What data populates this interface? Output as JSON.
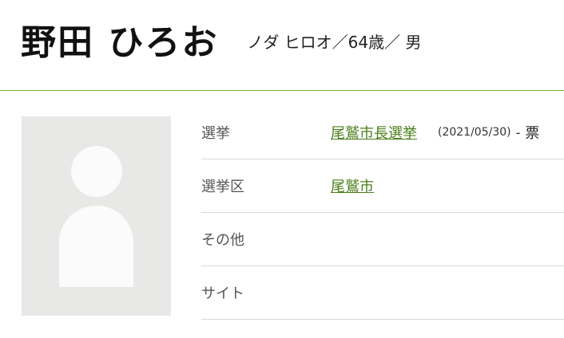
{
  "profile": {
    "name": "野田 ひろお",
    "reading": "ノダ ヒロオ／64歳／ 男"
  },
  "info": {
    "rows": [
      {
        "label": "選挙",
        "link": "尾鷲市長選挙",
        "date": "(2021/05/30)",
        "dash": "-",
        "votes": "票"
      },
      {
        "label": "選挙区",
        "link": "尾鷲市"
      },
      {
        "label": "その他"
      },
      {
        "label": "サイト"
      }
    ]
  },
  "colors": {
    "accent": "#7cb342",
    "link": "#4a7f1a",
    "photo_bg": "#e8e8e6",
    "row_border": "#d9d9d9"
  }
}
